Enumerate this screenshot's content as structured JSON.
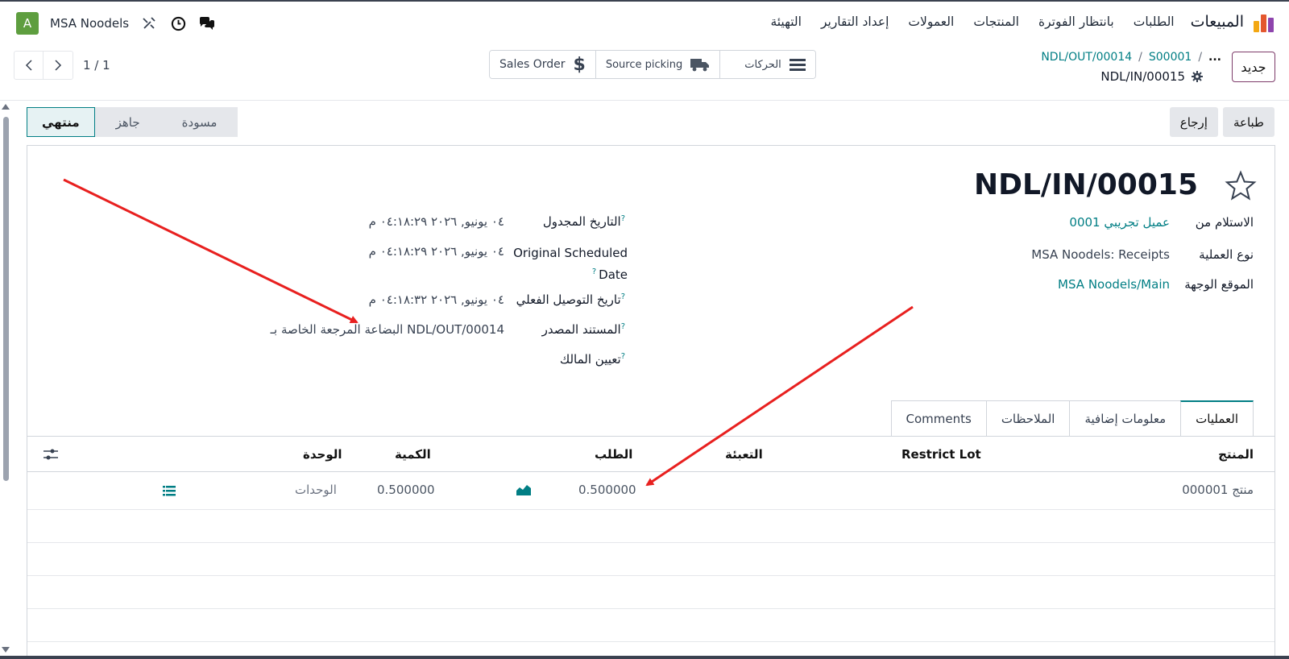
{
  "nav": {
    "brand": "المبيعات",
    "items": [
      "الطلبات",
      "بانتظار الفوترة",
      "المنتجات",
      "العمولات",
      "إعداد التقارير",
      "التهيئة"
    ],
    "company": "MSA Noodels",
    "avatar_letter": "A",
    "logo_colors": [
      "#f3a712",
      "#e4572e",
      "#8e44ad"
    ]
  },
  "control": {
    "new_label": "جديد",
    "breadcrumb": [
      "NDL/OUT/00014",
      "S00001",
      "..."
    ],
    "current_record": "NDL/IN/00015",
    "smart_buttons": [
      {
        "label": "الحركات",
        "icon": "bars-icon"
      },
      {
        "label": "Source picking",
        "icon": "truck-icon"
      },
      {
        "label": "Sales Order",
        "icon": "dollar-icon"
      }
    ],
    "pager": "1 / 1"
  },
  "status": {
    "stages": [
      "مسودة",
      "جاهز",
      "منتهي"
    ],
    "active": "منتهي",
    "actions": [
      "طباعة",
      "إرجاع"
    ]
  },
  "record": {
    "title": "NDL/IN/00015",
    "left_fields": {
      "receive_from_label": "الاستلام من",
      "receive_from_value": "عميل تجريبي 0001",
      "operation_type_label": "نوع العملية",
      "operation_type_value": "MSA Noodels: Receipts",
      "destination_label": "الموقع الوجهة",
      "destination_value": "MSA Noodels/Main"
    },
    "right_fields": {
      "scheduled_label": "التاريخ المجدول",
      "scheduled_value": "٠٤ يونيو, ٢٠٢٦ ٠٤:١٨:٢٩ م",
      "orig_scheduled_label_1": "Original Scheduled",
      "orig_scheduled_label_2": "Date",
      "orig_scheduled_value": "٠٤ يونيو, ٢٠٢٦ ٠٤:١٨:٢٩ م",
      "effective_label": "تاريخ التوصيل الفعلي",
      "effective_value": "٠٤ يونيو, ٢٠٢٦ ٠٤:١٨:٣٢ م",
      "source_label": "المستند المصدر",
      "source_value": "البضاعة المرجعة الخاصة بـ NDL/OUT/00014",
      "owner_label": "تعيين المالك"
    }
  },
  "tabs": [
    "العمليات",
    "معلومات إضافية",
    "الملاحظات",
    "Comments"
  ],
  "grid": {
    "headers": {
      "product": "المنتج",
      "restrict_lot": "Restrict Lot",
      "packaging": "التعبئة",
      "demand": "الطلب",
      "quantity": "الكمية",
      "unit": "الوحدة"
    },
    "rows": [
      {
        "product": "منتج 000001",
        "demand": "0.500000",
        "quantity": "0.500000",
        "unit": "الوحدات"
      }
    ]
  },
  "colors": {
    "accent": "#017e84",
    "brand_primary": "#7d3b6a",
    "arrow": "#e8201f"
  }
}
